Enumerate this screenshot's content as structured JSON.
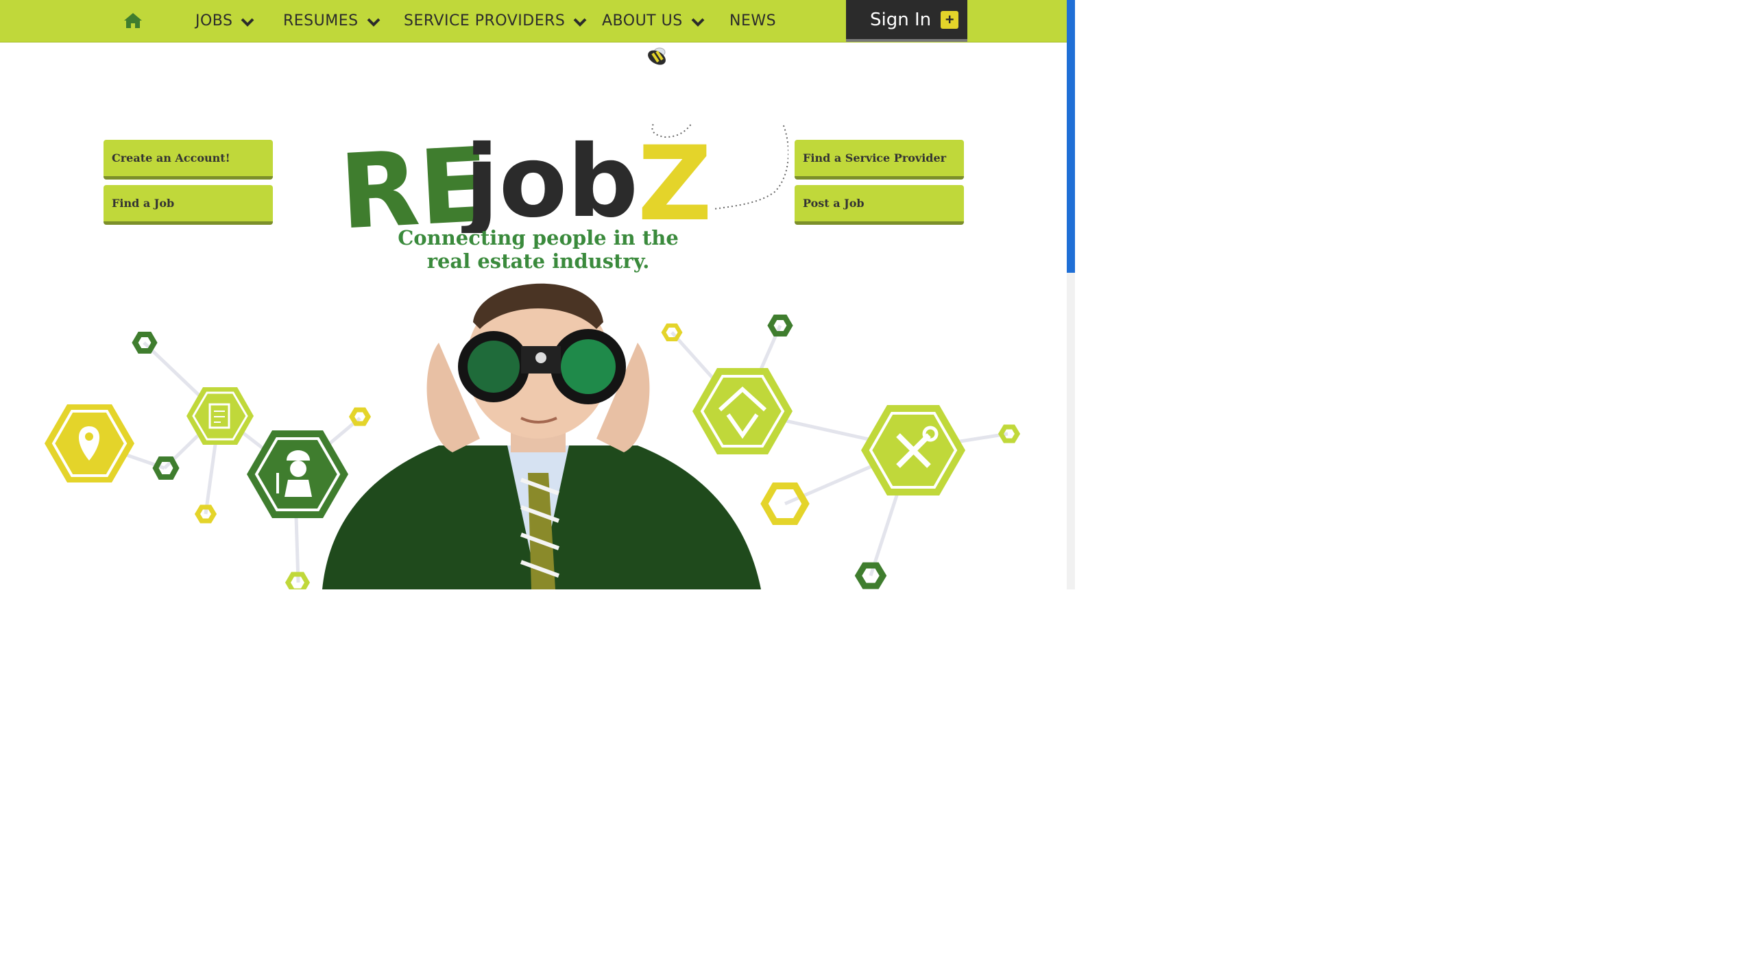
{
  "nav": {
    "home_icon": "home-icon",
    "items": [
      {
        "label": "JOBS",
        "has_dropdown": true
      },
      {
        "label": "RESUMES",
        "has_dropdown": true
      },
      {
        "label": "SERVICE PROVIDERS",
        "has_dropdown": true
      },
      {
        "label": "ABOUT US",
        "has_dropdown": true
      },
      {
        "label": "NEWS",
        "has_dropdown": false
      }
    ],
    "signin_label": "Sign In",
    "signin_icon": "plus-icon"
  },
  "left_buttons": [
    {
      "label": "Create an Account!"
    },
    {
      "label": "Find a Job"
    }
  ],
  "right_buttons": [
    {
      "label": "Find a Service Provider"
    },
    {
      "label": "Post a Job"
    }
  ],
  "logo": {
    "part_re": "RE",
    "part_job": "job",
    "part_z": "Z"
  },
  "tagline": {
    "line1": "Connecting people in the",
    "line2": "real estate industry."
  },
  "colors": {
    "nav_bg": "#c0d83a",
    "dark_green": "#3f7d2e",
    "lime": "#c0d83a",
    "yellow": "#e4d42a",
    "charcoal": "#2b2b2b"
  },
  "hero_icons": [
    "location-pin-icon",
    "document-icon",
    "construction-worker-icon",
    "house-icon",
    "tools-icon",
    "bee-icon"
  ]
}
